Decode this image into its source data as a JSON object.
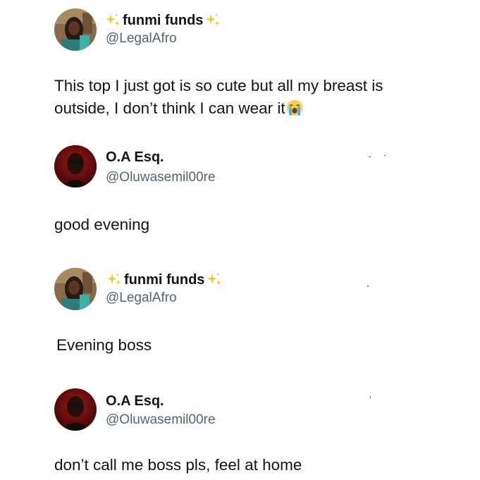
{
  "tweets": [
    {
      "display_name": "funmi funds",
      "verified_sparkles": true,
      "handle": "@LegalAfro",
      "text": "This top I just got is so cute but all my breast is outside, I don’t think I can wear it",
      "trailing_emoji": "loudly-crying-face-emoji",
      "avatar": "woman-selfie-avatar"
    },
    {
      "display_name": "O.A Esq.",
      "verified_sparkles": false,
      "handle": "@Oluwasemil00re",
      "text": "good evening",
      "avatar": "man-portrait-avatar"
    },
    {
      "display_name": "funmi funds",
      "verified_sparkles": true,
      "handle": "@LegalAfro",
      "text": "Evening boss",
      "avatar": "woman-selfie-avatar"
    },
    {
      "display_name": "O.A Esq.",
      "verified_sparkles": false,
      "handle": "@Oluwasemil00re",
      "text": "don’t call me boss pls, feel at home",
      "avatar": "man-portrait-avatar"
    }
  ],
  "colors": {
    "text_primary": "#0f1419",
    "text_secondary": "#536471",
    "sparkle_gold": "#f5c518",
    "background": "#ffffff"
  }
}
